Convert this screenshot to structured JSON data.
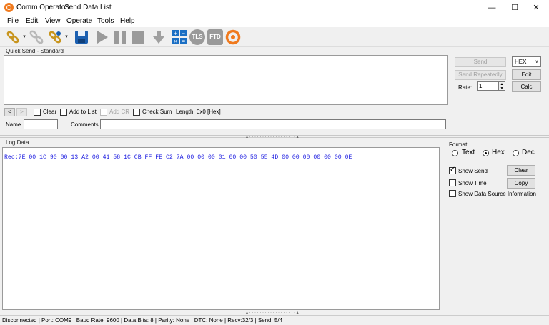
{
  "window": {
    "app_name": "Comm Operator",
    "tab_title": "Send Data List",
    "minimize_glyph": "—",
    "maximize_glyph": "☐",
    "close_glyph": "✕"
  },
  "menu": [
    "File",
    "Edit",
    "View",
    "Operate",
    "Tools",
    "Help"
  ],
  "toolbar": {
    "icons": [
      "connect-icon",
      "disconnect-icon",
      "connect-config-icon",
      "save-icon",
      "play-icon",
      "pause-icon",
      "stop-icon",
      "download-icon",
      "calculator-icon",
      "tls-icon",
      "ftd-icon",
      "comm-operator-icon"
    ],
    "tls_label": "TLS",
    "ftd_label": "FTD"
  },
  "quick_send": {
    "title": "Quick Send - Standard",
    "send_label": "Send",
    "send_repeatedly_label": "Send Repeatedly",
    "format_value": "HEX",
    "edit_label": "Edit",
    "rate_label": "Rate:",
    "rate_value": "1",
    "calc_label": "Calc",
    "prev_glyph": "<",
    "next_glyph": ">",
    "clear_label": "Clear",
    "add_to_list_label": "Add to List",
    "add_cr_label": "Add CR",
    "check_sum_label": "Check Sum",
    "length_text": "Length: 0x0 [Hex]",
    "name_label": "Name",
    "name_value": "",
    "comments_label": "Comments",
    "comments_value": ""
  },
  "log": {
    "title": "Log Data",
    "line": "Rec:7E 00 1C 90 00 13 A2 00 41 58 1C CB FF FE C2 7A 00 00 00 01 00 00 50 55 4D 00 00 00 00 00 00 0E",
    "format_title": "Format",
    "formats": [
      "Text",
      "Hex",
      "Dec"
    ],
    "selected_format": "Hex",
    "show_send_label": "Show Send",
    "show_send_checked": true,
    "show_time_label": "Show Time",
    "show_time_checked": false,
    "show_source_label": "Show Data Source Information",
    "show_source_checked": false,
    "clear_label": "Clear",
    "copy_label": "Copy"
  },
  "status": {
    "text": "Disconnected | Port: COM9 | Baud Rate: 9600 | Data Bits: 8 | Parity: None | DTC: None | Recv:32/3 | Send: 5/4"
  },
  "colors": {
    "accent_orange": "#f07a1e",
    "log_text_blue": "#1a1ae0",
    "save_blue": "#1b5fb0"
  }
}
